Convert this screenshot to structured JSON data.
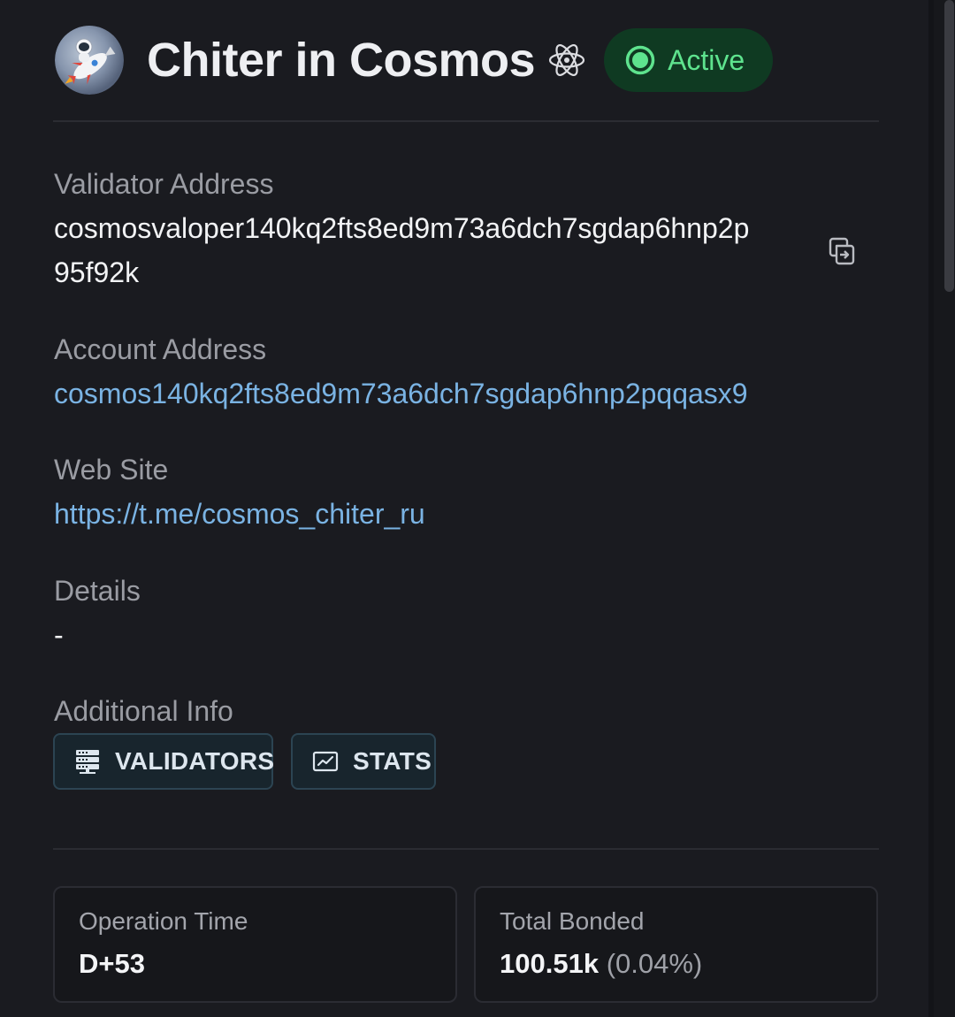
{
  "validator": {
    "name": "Chiter in Cosmos",
    "status": "Active",
    "avatar_icon": "astronaut-rocket-avatar",
    "badge_icon": "atom-icon"
  },
  "fields": {
    "validator_address": {
      "label": "Validator Address",
      "value_line1": "cosmosvaloper140kq2fts8ed9m73a6dch7sgdap6hnp2p",
      "value_line2": "95f92k"
    },
    "account_address": {
      "label": "Account Address",
      "value": "cosmos140kq2fts8ed9m73a6dch7sgdap6hnp2pqqasx9"
    },
    "web_site": {
      "label": "Web Site",
      "value": "https://t.me/cosmos_chiter_ru"
    },
    "details": {
      "label": "Details",
      "value": "-"
    },
    "additional_info": {
      "label": "Additional Info",
      "buttons": [
        {
          "label": "VALIDATORS",
          "icon": "server-rack-icon"
        },
        {
          "label": "STATS",
          "icon": "chart-window-icon"
        }
      ]
    }
  },
  "stats": {
    "operation_time": {
      "label": "Operation Time",
      "value": "D+53"
    },
    "total_bonded": {
      "label": "Total Bonded",
      "value": "100.51k",
      "percent": "(0.04%)"
    }
  },
  "colors": {
    "background": "#1a1b20",
    "active_green": "#5ee38e",
    "active_pill_bg": "#0f3a22",
    "link_blue": "#7ab3e3",
    "button_border": "#2c4452"
  }
}
